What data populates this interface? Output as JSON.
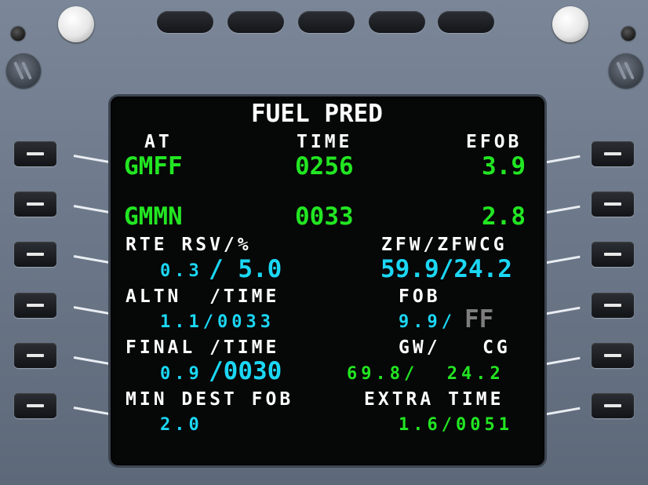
{
  "page": {
    "title": "FUEL PRED"
  },
  "headers": {
    "at": "AT",
    "time": "TIME",
    "efob": "EFOB"
  },
  "rows": {
    "dest1": {
      "airport": "GMFF",
      "time": "0256",
      "efob": "3.9"
    },
    "dest2": {
      "airport": "GMMN",
      "time": "0033",
      "efob": "2.8"
    }
  },
  "labels": {
    "rte_rsv": "RTE RSV/%",
    "zfw_zfwcg": "ZFW/ZFWCG",
    "altn_time": "ALTN  /TIME",
    "fob": "FOB",
    "final_time": "FINAL /TIME",
    "gw_cg": "GW/   CG",
    "min_dest_fob": "MIN DEST FOB",
    "extra_time": "EXTRA TIME"
  },
  "values": {
    "rte_rsv_fuel": "0.3",
    "rte_rsv_pct": "/ 5.0",
    "zfw_zfwcg": "59.9/24.2",
    "altn_time": "1.1/0033",
    "fob_value": "9.9/",
    "fob_ff": "FF",
    "final_fuel": "0.9",
    "final_time": "/0030",
    "gw_cg": "69.8/  24.2",
    "min_dest_fob": "2.0",
    "extra_time": "1.6/0051"
  },
  "colors": {
    "white": "#ffffff",
    "green": "#22e622",
    "cyan": "#1bd7f4",
    "gray": "#7d7d7d"
  }
}
